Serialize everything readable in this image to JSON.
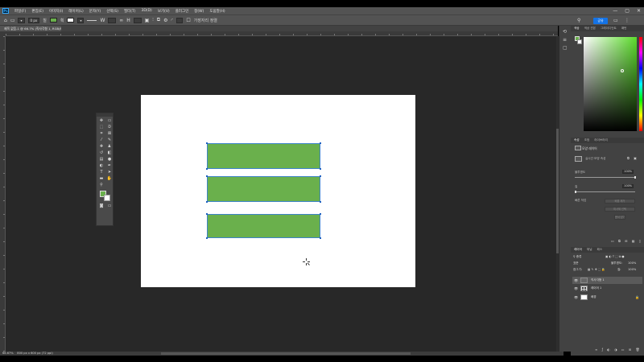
{
  "app": {
    "logo": "Ps",
    "menu": [
      "파일(F)",
      "편집(E)",
      "이미지(I)",
      "레이어(L)",
      "문자(Y)",
      "선택(S)",
      "필터(T)",
      "3D(D)",
      "보기(V)",
      "플러그인",
      "창(W)",
      "도움말(H)"
    ],
    "window_controls": [
      "—",
      "▢",
      "✕"
    ]
  },
  "options_bar": {
    "size_value": "0 px",
    "fill_label": "칠",
    "stroke_label": "획",
    "link_label": "가장자리 정렬",
    "share_label": "공유",
    "accent_color": "#1473e6"
  },
  "document": {
    "tab_title": "제목 없음-1 @ 66.7% (직사각형 1, RGB/8) *"
  },
  "canvas_shapes": {
    "color": "#6ab04c",
    "selection_color": "#3d84c8",
    "count": 3
  },
  "tools": [
    {
      "icon": "move-icon",
      "glyph": "✥"
    },
    {
      "icon": "artboard-icon",
      "glyph": "▭"
    },
    {
      "icon": "marquee-icon",
      "glyph": "⬚"
    },
    {
      "icon": "lasso-icon",
      "glyph": "ᘐ"
    },
    {
      "icon": "crop-icon",
      "glyph": "⌗"
    },
    {
      "icon": "frame-icon",
      "glyph": "⊠"
    },
    {
      "icon": "eyedropper-icon",
      "glyph": "⁄"
    },
    {
      "icon": "brush-icon",
      "glyph": "✎"
    },
    {
      "icon": "healing-icon",
      "glyph": "✚"
    },
    {
      "icon": "stamp-icon",
      "glyph": "♟"
    },
    {
      "icon": "history-brush-icon",
      "glyph": "↺"
    },
    {
      "icon": "eraser-icon",
      "glyph": "◧"
    },
    {
      "icon": "gradient-icon",
      "glyph": "▤"
    },
    {
      "icon": "blur-icon",
      "glyph": "●"
    },
    {
      "icon": "dodge-icon",
      "glyph": "◐"
    },
    {
      "icon": "pen-icon",
      "glyph": "✒"
    },
    {
      "icon": "type-icon",
      "glyph": "T"
    },
    {
      "icon": "path-select-icon",
      "glyph": "➤"
    },
    {
      "icon": "rectangle-icon",
      "glyph": "▬"
    },
    {
      "icon": "hand-icon",
      "glyph": "✋"
    },
    {
      "icon": "zoom-icon",
      "glyph": "⚲"
    }
  ],
  "status": {
    "zoom": "66.67%",
    "doc_info": "800 px x 600 px (72 ppi)"
  },
  "color_panel": {
    "tabs": [
      "색상",
      "색상 견본",
      "그레이디언트",
      "패턴"
    ]
  },
  "properties_panel": {
    "tabs": [
      "속성",
      "조정",
      "라이브러리"
    ],
    "kind": "모양 레이어",
    "sub": "실시간 모양 속성",
    "opacity_label": "불투명도",
    "opacity_value": "100%",
    "fill_label": "칠",
    "fill_value": "100%",
    "quick_actions_label": "빠른 작업",
    "actions": [
      "배경 제거",
      "피사체 선택",
      "문서 닫기"
    ]
  },
  "layers_panel": {
    "tabs": [
      "레이어",
      "채널",
      "패스"
    ],
    "filter_label": "종류",
    "blend_mode": "표준",
    "opacity_label": "불투명도:",
    "opacity_value": "100%",
    "lock_label": "잠그기:",
    "fill_label": "칠:",
    "fill_value": "100%",
    "layers": [
      {
        "name": "직사각형 1",
        "thumb": "shape"
      },
      {
        "name": "레이어 1",
        "thumb": "grid"
      },
      {
        "name": "배경",
        "thumb": "white"
      }
    ]
  }
}
